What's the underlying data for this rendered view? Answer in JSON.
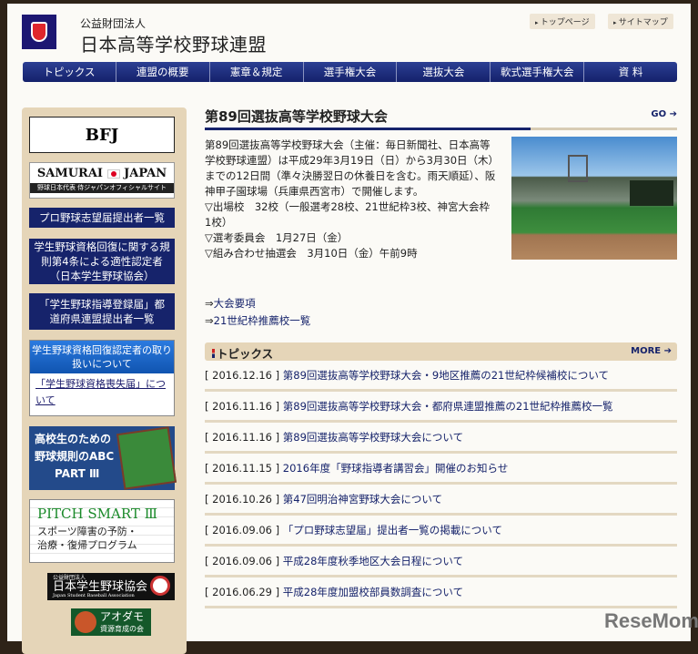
{
  "header": {
    "org_sub": "公益財団法人",
    "org_name": "日本高等学校野球連盟",
    "util_links": [
      "トップページ",
      "サイトマップ"
    ]
  },
  "nav": [
    "トピックス",
    "連盟の概要",
    "憲章＆規定",
    "選手権大会",
    "選抜大会",
    "軟式選手権大会",
    "資 料"
  ],
  "sidebar": {
    "bfj": "BFJ",
    "samurai": {
      "title_left": "SAMURAI",
      "title_right": "JAPAN",
      "subtitle": "野球日本代表 侍ジャパンオフィシャルサイト"
    },
    "pro_list": "プロ野球志望届提出者一覧",
    "rule4": "学生野球資格回復に関する規則第4条による適性認定者（日本学生野球協会）",
    "coach_reg": "「学生野球指導登録届」都道府県連盟提出者一覧",
    "recovery": {
      "heading": "学生野球資格回復認定者の取り扱いについて",
      "link": "「学生野球資格喪失届」について"
    },
    "abc": [
      "高校生のための",
      "野球規則のABC",
      "PART Ⅲ"
    ],
    "pitch": {
      "title": "PITCH SMART Ⅲ",
      "lines": [
        "スポーツ障害の予防・",
        "治療・復帰プログラム"
      ]
    },
    "jsba": {
      "sub": "公益財団法人",
      "name": "日本学生野球協会",
      "en": "Japan Student Baseball Association"
    },
    "aodamo": {
      "name": "アオダモ",
      "sub": "資源育成の会"
    }
  },
  "feature": {
    "title": "第89回選抜高等学校野球大会",
    "go": "GO ➔",
    "paragraphs": [
      "第89回選抜高等学校野球大会（主催：毎日新聞社、日本高等学校野球連盟）は平成29年3月19日（日）から3月30日（木）までの12日間（準々決勝翌日の休養日を含む。雨天順延）、阪神甲子園球場（兵庫県西宮市）で開催します。",
      "▽出場校　32校（一般選考28校、21世紀枠3校、神宮大会枠1校）",
      "▽選考委員会　1月27日（金）",
      "▽組み合わせ抽選会　3月10日（金）午前9時"
    ],
    "links": [
      {
        "prefix": "⇒",
        "label": "大会要項"
      },
      {
        "prefix": "⇒",
        "label": "21世紀枠推薦校一覧"
      }
    ]
  },
  "topics": {
    "heading": "トピックス",
    "more": "MORE ➔",
    "items": [
      {
        "date": "[ 2016.12.16 ]",
        "title": "第89回選抜高等学校野球大会・9地区推薦の21世紀枠候補校について"
      },
      {
        "date": "[ 2016.11.16 ]",
        "title": "第89回選抜高等学校野球大会・都府県連盟推薦の21世紀枠推薦校一覧"
      },
      {
        "date": "[ 2016.11.16 ]",
        "title": "第89回選抜高等学校野球大会について"
      },
      {
        "date": "[ 2016.11.15 ]",
        "title": "2016年度「野球指導者講習会」開催のお知らせ"
      },
      {
        "date": "[ 2016.10.26 ]",
        "title": "第47回明治神宮野球大会について"
      },
      {
        "date": "[ 2016.09.06 ]",
        "title": "「プロ野球志望届」提出者一覧の掲載について"
      },
      {
        "date": "[ 2016.09.06 ]",
        "title": "平成28年度秋季地区大会日程について"
      },
      {
        "date": "[ 2016.06.29 ]",
        "title": "平成28年度加盟校部員数調査について"
      }
    ]
  },
  "watermark": "ReseMom."
}
